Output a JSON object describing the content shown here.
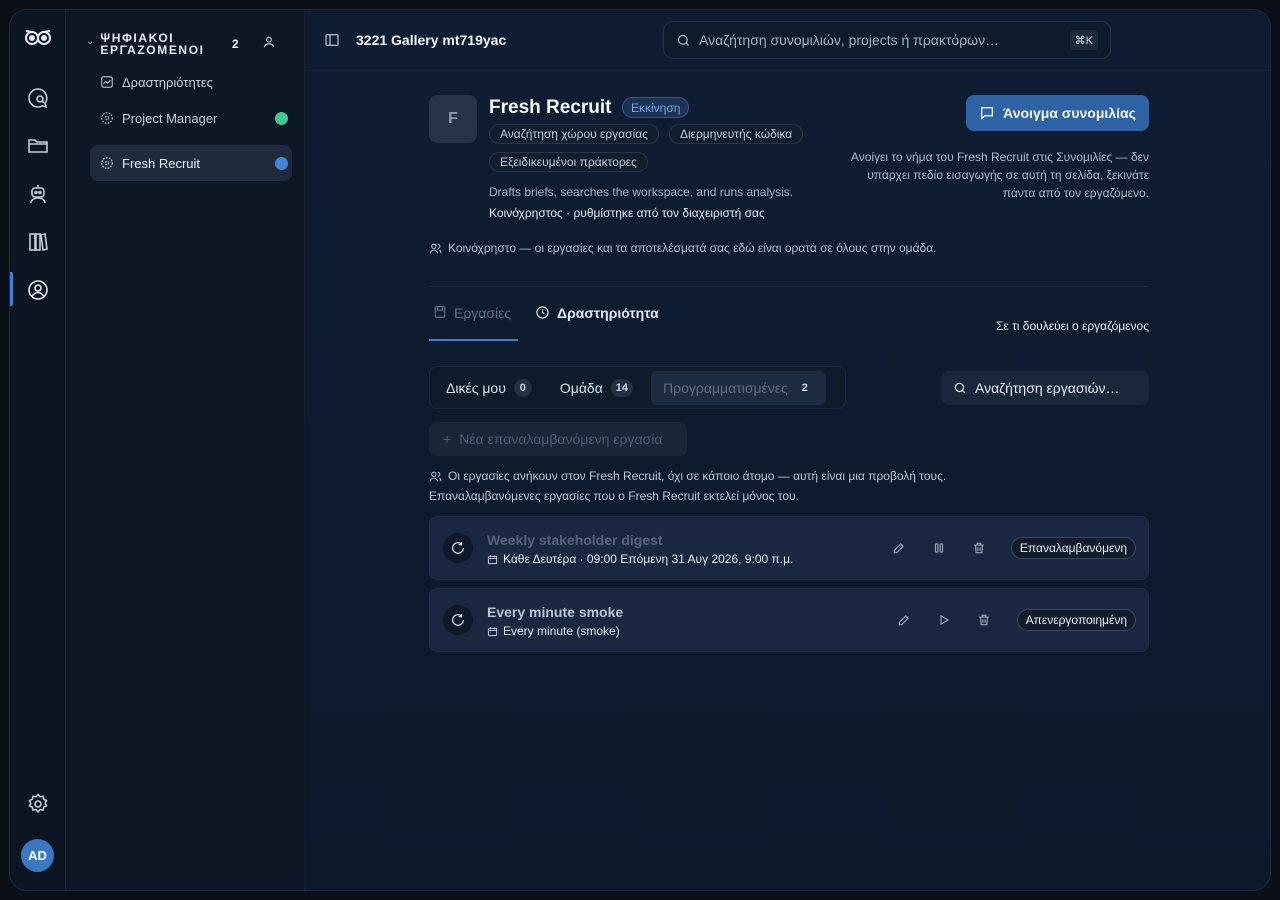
{
  "sidebar": {
    "title": "ΨΗΦΙΑΚΟΙ ΕΡΓΑΖΟΜΕΝΟΙ",
    "count": "2",
    "items": [
      {
        "label": "Δραστηριότητες",
        "icon": "activity-chart-icon"
      },
      {
        "label": "Project Manager",
        "icon": "agent-gear-icon",
        "status_color": "#3fc98f"
      },
      {
        "label": "Fresh Recruit",
        "icon": "agent-gear-icon",
        "status_color": "#3d86d8",
        "selected": true
      }
    ]
  },
  "rail": {
    "icons": [
      "owl-logo-icon",
      "chat-search-icon",
      "folder-icon",
      "robot-icon",
      "books-icon",
      "user-circle-icon",
      "gear-icon"
    ],
    "active": "user-circle-icon",
    "avatar": "AD"
  },
  "topbar": {
    "title": "3221 Gallery mt719yac",
    "search_placeholder": "Αναζήτηση συνομιλιών, projects ή πρακτόρων…",
    "shortcut": "⌘K"
  },
  "agent": {
    "avatar_letter": "F",
    "name": "Fresh Recruit",
    "status": "Εκκίνηση",
    "chips": [
      "Αναζήτηση χώρου εργασίας",
      "Διερμηνευτής κώδικα",
      "Εξειδικευμένοι πράκτορες"
    ],
    "description": "Drafts briefs, searches the workspace, and runs analysis.",
    "shared_line": "Κοινόχρηστος · ρυθμίστηκε από τον διαχειριστή σας",
    "open_button": "Άνοιγμα συνομιλίας",
    "open_note": "Ανοίγει το νήμα του Fresh Recruit στις Συνομιλίες — δεν υπάρχει πεδίο εισαγωγής σε αυτή τη σελίδα, ξεκινάτε πάντα από τον εργαζόμενο."
  },
  "shared_info": "Κοινόχρηστο — οι εργασίες και τα αποτελέσματά σας εδώ είναι ορατά σε όλους στην ομάδα.",
  "tabs": {
    "tasks": "Εργασίες",
    "activity": "Δραστηριότητα",
    "right_link": "Σε τι δουλεύει ο εργαζόμενος",
    "active": "tasks"
  },
  "filters": {
    "items": [
      {
        "label": "Δικές μου",
        "count": "0"
      },
      {
        "label": "Ομάδα",
        "count": "14"
      },
      {
        "label": "Προγραμματισμένες",
        "count": "2",
        "selected": true
      }
    ],
    "search_placeholder": "Αναζήτηση εργασιών…"
  },
  "new_task_button": "Νέα επαναλαμβανόμενη εργασία",
  "notes": {
    "line1": "Οι εργασίες ανήκουν στον Fresh Recruit, όχι σε κάποιο άτομο — αυτή είναι μια προβολή τους.",
    "line2": "Επαναλαμβανόμενες εργασίες που ο Fresh Recruit εκτελεί μόνος του."
  },
  "tasks": [
    {
      "name": "Weekly stakeholder digest",
      "schedule": "Κάθε Δευτέρα · 09:00 Επόμενη 31 Αυγ 2026, 9:00 π.μ.",
      "state": "Επαναλαμβανόμενη",
      "name_color": "#56647b",
      "actions": [
        "edit-icon",
        "pause-icon",
        "trash-icon"
      ]
    },
    {
      "name": "Every minute smoke",
      "schedule": "Every minute (smoke)",
      "state": "Απενεργοποιημένη",
      "name_color": "#b9c4d6",
      "actions": [
        "edit-icon",
        "play-icon",
        "trash-icon"
      ]
    }
  ],
  "colors": {
    "accent": "#2d62a3",
    "background": "#0f1a2c"
  }
}
